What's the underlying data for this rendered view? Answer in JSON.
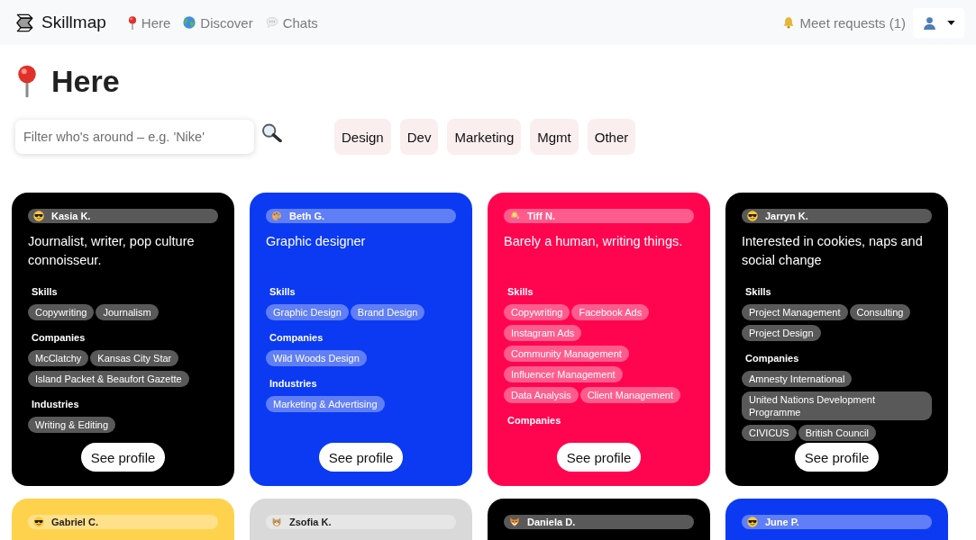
{
  "nav": {
    "brand": "Skillmap",
    "links": [
      {
        "label": "Here",
        "kind": "pin",
        "selected": false
      },
      {
        "label": "Discover",
        "kind": "globe",
        "selected": false
      },
      {
        "label": "Chats",
        "kind": "speech",
        "selected": false
      }
    ],
    "requests": "Meet requests (1)",
    "user_menu": {
      "expanded": false
    }
  },
  "page_title": "Here",
  "search": {
    "placeholder": "Filter who's around – e.g. 'Nike'"
  },
  "filters": [
    {
      "label": "Design",
      "selected": false
    },
    {
      "label": "Dev",
      "selected": false
    },
    {
      "label": "Marketing",
      "selected": false
    },
    {
      "label": "Mgmt",
      "selected": false
    },
    {
      "label": "Other",
      "selected": false
    }
  ],
  "cards": [
    {
      "name": "Kasia K.",
      "kind": "sunglasses",
      "color": "#000000",
      "bio": "Journalist, writer, pop culture connoisseur.",
      "sections": [
        {
          "title": "Skills",
          "tags": [
            "Copywriting",
            "Journalism"
          ]
        },
        {
          "title": "Companies",
          "tags": [
            "McClatchy",
            "Kansas City Star",
            "Island Packet & Beaufort Gazette"
          ]
        },
        {
          "title": "Industries",
          "tags": [
            "Writing & Editing"
          ]
        }
      ],
      "button": "See profile"
    },
    {
      "name": "Beth G.",
      "kind": "palette",
      "color": "#0b3af2",
      "bio": "Graphic designer",
      "sections": [
        {
          "title": "Skills",
          "tags": [
            "Graphic Design",
            "Brand Design"
          ]
        },
        {
          "title": "Companies",
          "tags": [
            "Wild Woods Design"
          ]
        },
        {
          "title": "Industries",
          "tags": [
            "Marketing & Advertising"
          ]
        }
      ],
      "button": "See profile"
    },
    {
      "name": "Tiff N.",
      "kind": "woman",
      "color": "#ff0550",
      "bio": "Barely a human, writing things.",
      "sections": [
        {
          "title": "Skills",
          "tags": [
            "Copywriting",
            "Facebook Ads",
            "Instagram Ads",
            "Community Management",
            "Influencer Management",
            "Data Analysis",
            "Client Management"
          ]
        },
        {
          "title": "Companies"
        }
      ],
      "button": "See profile"
    },
    {
      "name": "Jarryn K.",
      "kind": "sunglasses",
      "color": "#000000",
      "bio": "Interested in cookies, naps and social change",
      "sections": [
        {
          "title": "Skills",
          "tags": [
            "Project Management",
            "Consulting",
            "Project Design"
          ]
        },
        {
          "title": "Companies",
          "tags": [
            "Amnesty International",
            "United Nations Development Programme",
            "CIVICUS",
            "British Council"
          ]
        }
      ],
      "button": "See profile"
    },
    {
      "name": "Gabriel C.",
      "kind": "sunglasses",
      "color": "#ffd24d"
    },
    {
      "name": "Zsofia K.",
      "kind": "cat",
      "color": "#d9d9d9"
    },
    {
      "name": "Daniela D.",
      "kind": "fox",
      "color": "#000000"
    },
    {
      "name": "June P.",
      "kind": "sunglasses",
      "color": "#0b3af2"
    }
  ]
}
